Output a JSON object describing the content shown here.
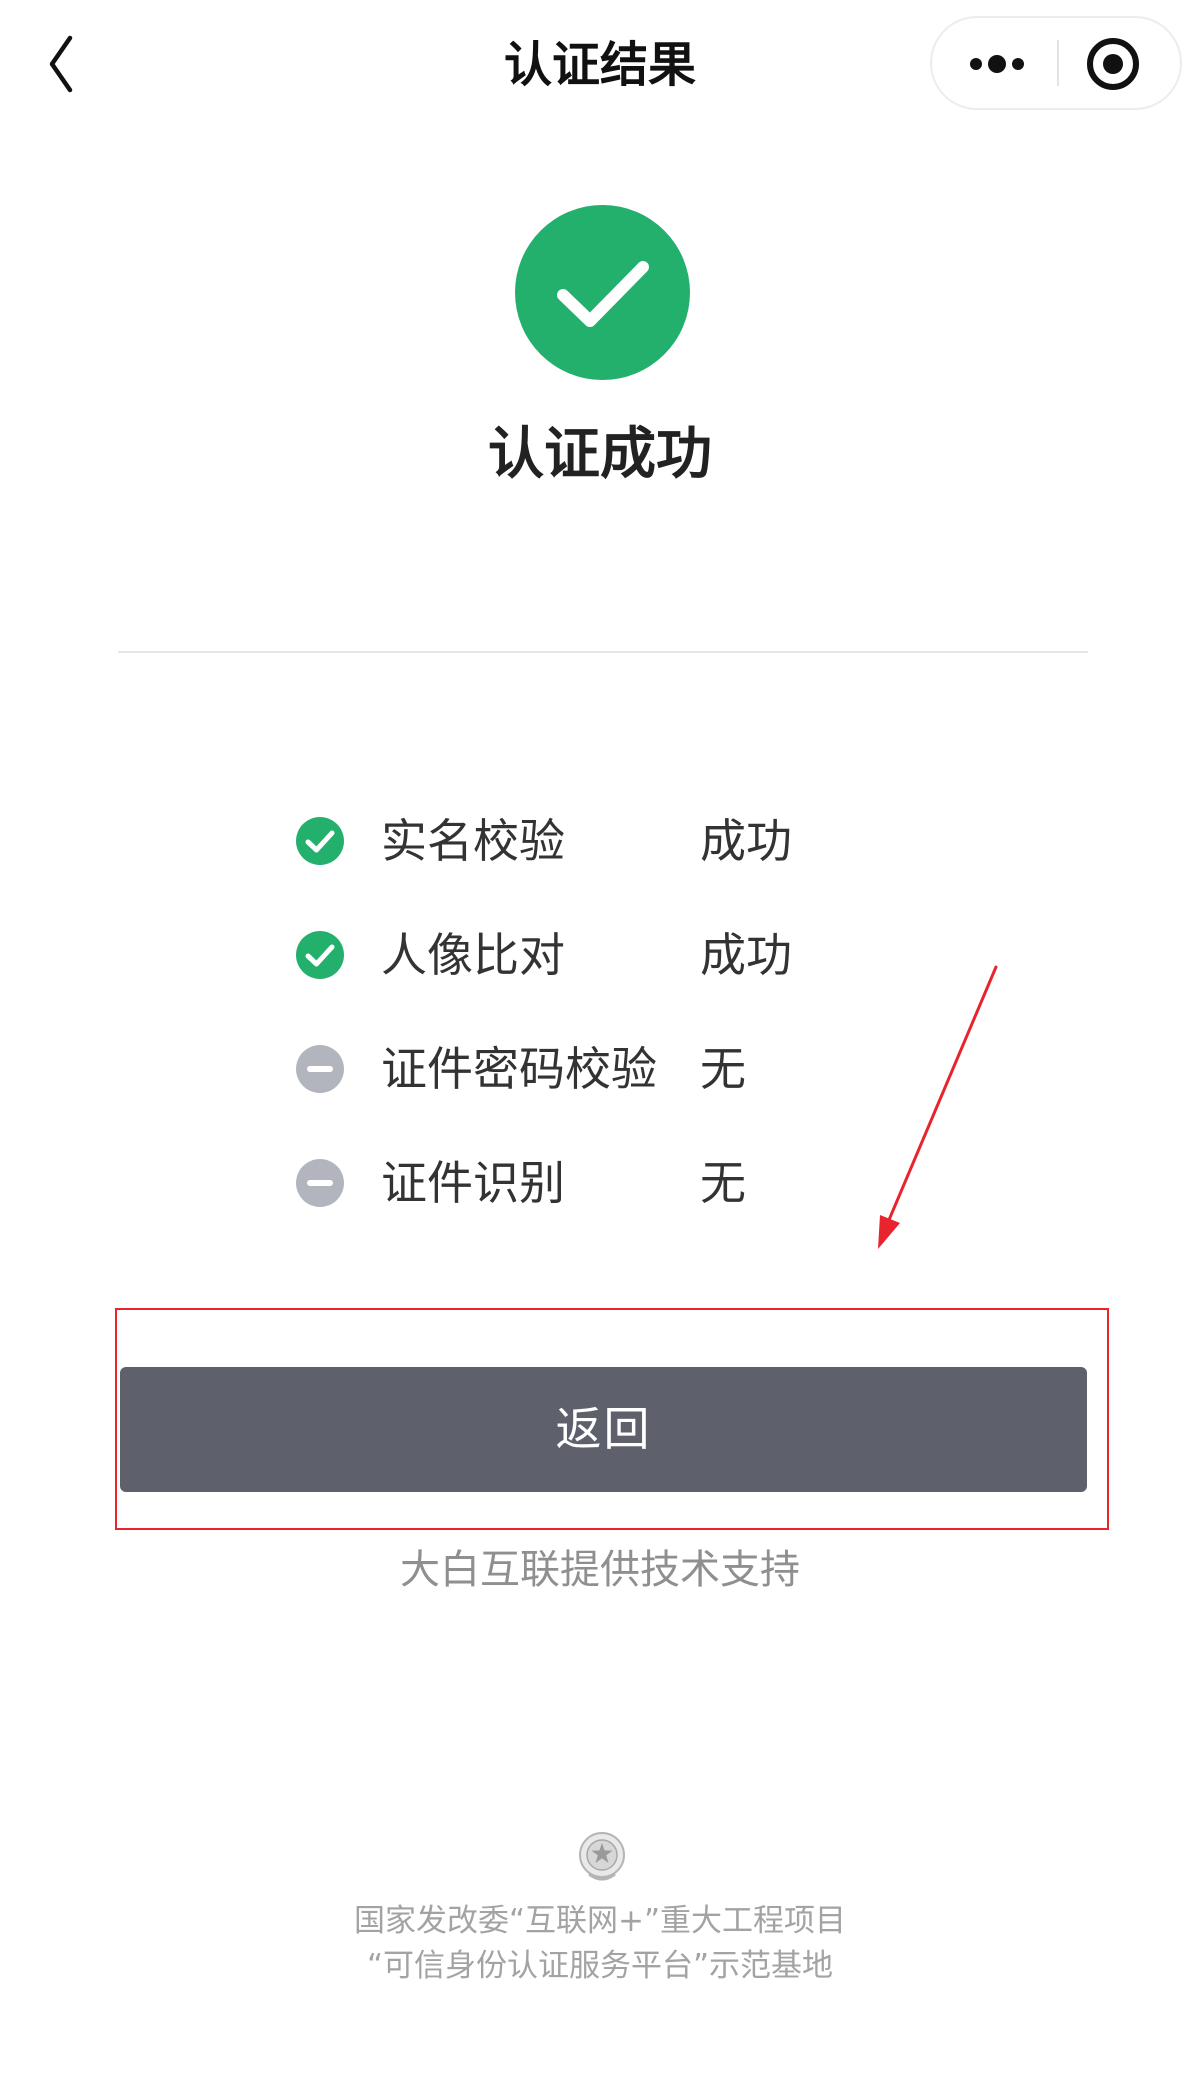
{
  "nav": {
    "title": "认证结果",
    "back_icon": "chevron-left-icon",
    "capsule_more_icon": "more-dots-icon",
    "capsule_close_icon": "target-close-icon"
  },
  "result": {
    "status_icon": "success-check-icon",
    "title": "认证成功",
    "accent_color": "#23b06d"
  },
  "checks": [
    {
      "label": "实名校验",
      "value": "成功",
      "status": "success"
    },
    {
      "label": "人像比对",
      "value": "成功",
      "status": "success"
    },
    {
      "label": "证件密码校验",
      "value": "无",
      "status": "none"
    },
    {
      "label": "证件识别",
      "value": "无",
      "status": "none"
    }
  ],
  "colors": {
    "success": "#23b06d",
    "none": "#b3b5be",
    "button": "#5e616c",
    "annotation": "#e8242c"
  },
  "actions": {
    "return_label": "返回"
  },
  "support_text": "大白互联提供技术支持",
  "footer": {
    "emblem_icon": "national-emblem-icon",
    "line1": "国家发改委“互联网+”重大工程项目",
    "line2": "“可信身份认证服务平台”示范基地"
  }
}
